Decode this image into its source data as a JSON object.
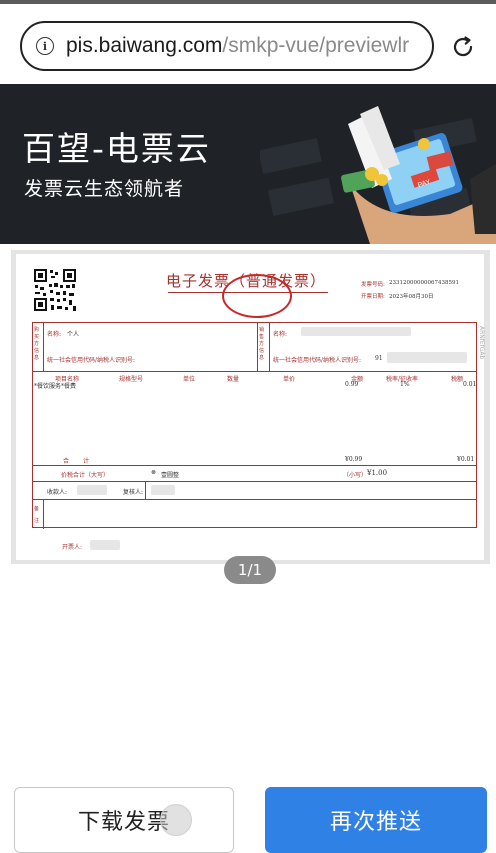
{
  "browser": {
    "url_host": "pis.baiwang.com",
    "url_path": "/smkp-vue/previewlr"
  },
  "banner": {
    "title": "百望-电票云",
    "subtitle": "发票云生态领航者",
    "art_tag": "PAY"
  },
  "invoice": {
    "title": "电子发票（普通发票）",
    "number_label": "发票号码:",
    "number_value": "23312000000067438591",
    "date_label": "开票日期:",
    "date_value": "2023年08月30日",
    "buyer_section_label": "购买方信息",
    "buyer_name_label": "名称:",
    "buyer_name_value": "个人",
    "buyer_tax_label": "统一社会信用代码/纳税人识别号:",
    "seller_section_label": "销售方信息",
    "seller_name_label": "名称:",
    "seller_tax_label": "统一社会信用代码/纳税人识别号:",
    "seller_tax_value_prefix": "91",
    "columns": [
      "项目名称",
      "规格型号",
      "单位",
      "数量",
      "单价",
      "金额",
      "税率/征收率",
      "税额"
    ],
    "item_name": "*餐饮服务*餐费",
    "item_amount": "0.99",
    "item_rate": "1%",
    "item_tax": "0.01",
    "total_label": "合计",
    "total_amount": "¥0.99",
    "total_tax": "¥0.01",
    "total_words_label": "价税合计（大写）",
    "total_words_value": "壹圆整",
    "total_small_label": "（小写）",
    "total_small_value": "¥1.00",
    "remark_label": "备注",
    "payee_label": "收款人:",
    "reviewer_label": "复核人:",
    "drawer_label": "开票人:",
    "side_text": "ARNfEfGAb"
  },
  "pager": {
    "text": "1/1"
  },
  "actions": {
    "download_label": "下载发票",
    "push_label": "再次推送"
  },
  "colors": {
    "banner_bg": "#1f2328",
    "invoice_red": "#a8312d",
    "seal_red": "#c9282a",
    "primary_blue": "#2f81e6"
  }
}
